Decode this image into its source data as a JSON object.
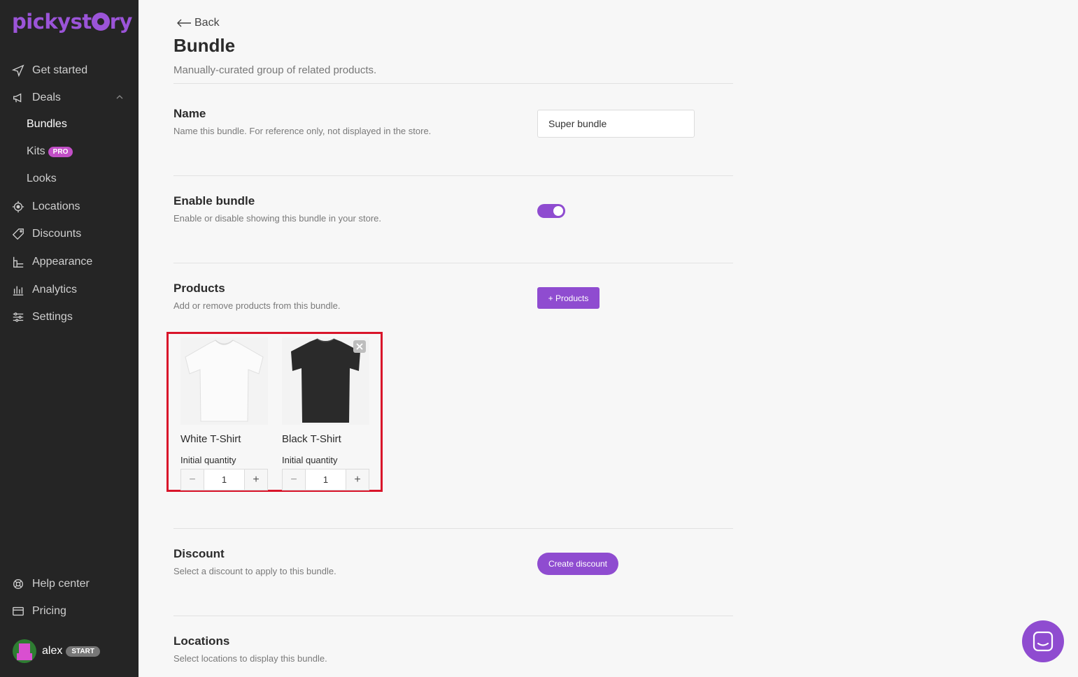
{
  "brand": {
    "logo_text_a": "pickyst",
    "logo_text_b": "ry",
    "accent": "#8f4cd0"
  },
  "sidebar": {
    "items": [
      {
        "label": "Get started",
        "icon": "navigation-arrow-icon"
      },
      {
        "label": "Deals",
        "icon": "megaphone-icon"
      },
      {
        "label": "Locations",
        "icon": "target-icon"
      },
      {
        "label": "Discounts",
        "icon": "tag-icon"
      },
      {
        "label": "Appearance",
        "icon": "layout-icon"
      },
      {
        "label": "Analytics",
        "icon": "bar-chart-icon"
      },
      {
        "label": "Settings",
        "icon": "sliders-icon"
      }
    ],
    "deals_sub": [
      {
        "label": "Bundles"
      },
      {
        "label": "Kits",
        "badge": "PRO"
      },
      {
        "label": "Looks"
      }
    ],
    "footer": [
      {
        "label": "Help center",
        "icon": "lifebuoy-icon"
      },
      {
        "label": "Pricing",
        "icon": "credit-card-icon"
      }
    ],
    "user": {
      "name": "alex",
      "plan": "START"
    }
  },
  "page": {
    "back_label": "Back",
    "title": "Bundle",
    "subtitle": "Manually-curated group of related products."
  },
  "sections": {
    "name": {
      "title": "Name",
      "desc": "Name this bundle. For reference only, not displayed in the store.",
      "value": "Super bundle"
    },
    "enable": {
      "title": "Enable bundle",
      "desc": "Enable or disable showing this bundle in your store.",
      "enabled": true
    },
    "products": {
      "title": "Products",
      "desc": "Add or remove products from this bundle.",
      "button": "+ Products"
    },
    "discount": {
      "title": "Discount",
      "desc": "Select a discount to apply to this bundle.",
      "button": "Create discount"
    },
    "locations": {
      "title": "Locations",
      "desc": "Select locations to display this bundle."
    }
  },
  "products": [
    {
      "name": "White T-Shirt",
      "qty_label": "Initial quantity",
      "qty": "1",
      "color": "#f4f4f4"
    },
    {
      "name": "Black T-Shirt",
      "qty_label": "Initial quantity",
      "qty": "1",
      "color": "#2a2a2a"
    }
  ],
  "stepper": {
    "minus": "−",
    "plus": "+"
  }
}
